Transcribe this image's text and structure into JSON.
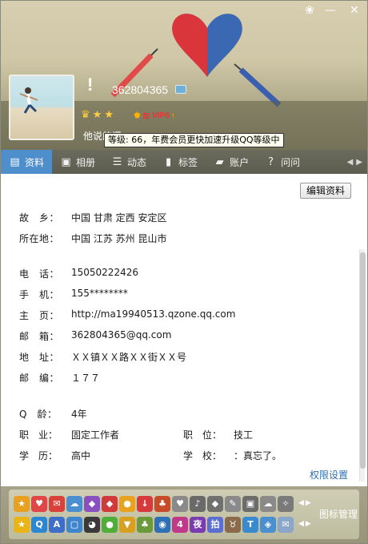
{
  "window": {
    "skin_icon": "skin-icon",
    "minimize": "—",
    "close": "✕"
  },
  "profile": {
    "uin": "362804365",
    "exclaim": "!",
    "vip_label": "VIP6",
    "year_label": "年",
    "signature": "他说的漠",
    "tooltip": "等级: 66，年费会员更快加速升级QQ等级中"
  },
  "tabs": [
    {
      "label": "资料",
      "icon": "profile-card-icon"
    },
    {
      "label": "相册",
      "icon": "photo-album-icon"
    },
    {
      "label": "动态",
      "icon": "feed-list-icon"
    },
    {
      "label": "标签",
      "icon": "bookmark-icon"
    },
    {
      "label": "账户",
      "icon": "briefcase-icon"
    },
    {
      "label": "问问",
      "icon": "question-icon"
    }
  ],
  "edit_button": "编辑资料",
  "fields": {
    "hometown": {
      "label": "故　乡：",
      "value": "中国 甘肃 定西 安定区"
    },
    "location": {
      "label": "所在地：",
      "value": "中国 江苏 苏州 昆山市"
    },
    "phone": {
      "label": "电　话：",
      "value": "15050222426"
    },
    "mobile": {
      "label": "手　机：",
      "value": "155********"
    },
    "homepage": {
      "label": "主　页：",
      "value": "http://ma19940513.qzone.qq.com"
    },
    "email": {
      "label": "邮　箱：",
      "value": "362804365@qq.com"
    },
    "address": {
      "label": "地　址：",
      "value": "ＸＸ镇ＸＸ路ＸＸ街ＸＸ号"
    },
    "zipcode": {
      "label": "邮　编：",
      "value": "１７７"
    },
    "qage": {
      "label": "Q　龄：",
      "value": "4年"
    },
    "occupation": {
      "label": "职　业：",
      "value": "固定工作者"
    },
    "position": {
      "label": "职　位：",
      "value": "技工"
    },
    "education": {
      "label": "学　历：",
      "value": "高中"
    },
    "school": {
      "label": "学　校：",
      "value": "：真忘了。"
    }
  },
  "permission_link": "权限设置",
  "icon_manage": "图标管理",
  "icon_rows": [
    [
      {
        "n": "qzone-icon",
        "c": "#e8a020",
        "t": "★"
      },
      {
        "n": "mail-heart-icon",
        "c": "#e04646",
        "t": "♥"
      },
      {
        "n": "gift-icon",
        "c": "#d9423a",
        "t": "✉"
      },
      {
        "n": "cloud-icon",
        "c": "#4a90d0",
        "t": "☁"
      },
      {
        "n": "diamond-purple-icon",
        "c": "#8a50c0",
        "t": "◆"
      },
      {
        "n": "diamond-red-icon",
        "c": "#d03a3a",
        "t": "◆"
      },
      {
        "n": "pet-icon",
        "c": "#e9a21e",
        "t": "●"
      },
      {
        "n": "download-icon",
        "c": "#d63a3a",
        "t": "↓"
      },
      {
        "n": "game-icon",
        "c": "#c84b28",
        "t": "♣"
      },
      {
        "n": "heart-gray-icon",
        "c": "#8a8a8a",
        "t": "♥"
      },
      {
        "n": "music-icon",
        "c": "#6a6a6a",
        "t": "♪"
      },
      {
        "n": "diamond-gray-icon",
        "c": "#707070",
        "t": "◆"
      },
      {
        "n": "chat-gray-icon",
        "c": "#8a8a8a",
        "t": "✎"
      },
      {
        "n": "tv-icon",
        "c": "#6c6c6c",
        "t": "▣"
      },
      {
        "n": "cloud-gray-icon",
        "c": "#8a8a8a",
        "t": "☁"
      },
      {
        "n": "star-gray-icon",
        "c": "#7a7a7a",
        "t": "✧"
      }
    ],
    [
      {
        "n": "yellow-star-icon",
        "c": "#e8b416",
        "t": "★"
      },
      {
        "n": "qq-blue-icon",
        "c": "#2d86d1",
        "t": "Q"
      },
      {
        "n": "app-icon",
        "c": "#3d6ec9",
        "t": "A"
      },
      {
        "n": "photo-icon",
        "c": "#3f86cf",
        "t": "▢"
      },
      {
        "n": "penguin-icon",
        "c": "#3a3a3a",
        "t": "◕"
      },
      {
        "n": "wechat-icon",
        "c": "#4fae38",
        "t": "●"
      },
      {
        "n": "shield-icon",
        "c": "#d8a020",
        "t": "▼"
      },
      {
        "n": "plant-icon",
        "c": "#6a9a3a",
        "t": "♣"
      },
      {
        "n": "eye-icon",
        "c": "#2f6fb5",
        "t": "◉"
      },
      {
        "n": "level-icon",
        "c": "#c03a8a",
        "t": "4"
      },
      {
        "n": "game-night-icon",
        "c": "#7a3ab0",
        "t": "夜"
      },
      {
        "n": "paipai-icon",
        "c": "#5a6fd0",
        "t": "拍"
      },
      {
        "n": "cow-icon",
        "c": "#8a6a4a",
        "t": "♉"
      },
      {
        "n": "security-icon",
        "c": "#3a8ad0",
        "t": "T"
      },
      {
        "n": "safe-icon",
        "c": "#4a90d0",
        "t": "◈"
      },
      {
        "n": "mail-icon",
        "c": "#8aa6c8",
        "t": "✉"
      }
    ]
  ]
}
